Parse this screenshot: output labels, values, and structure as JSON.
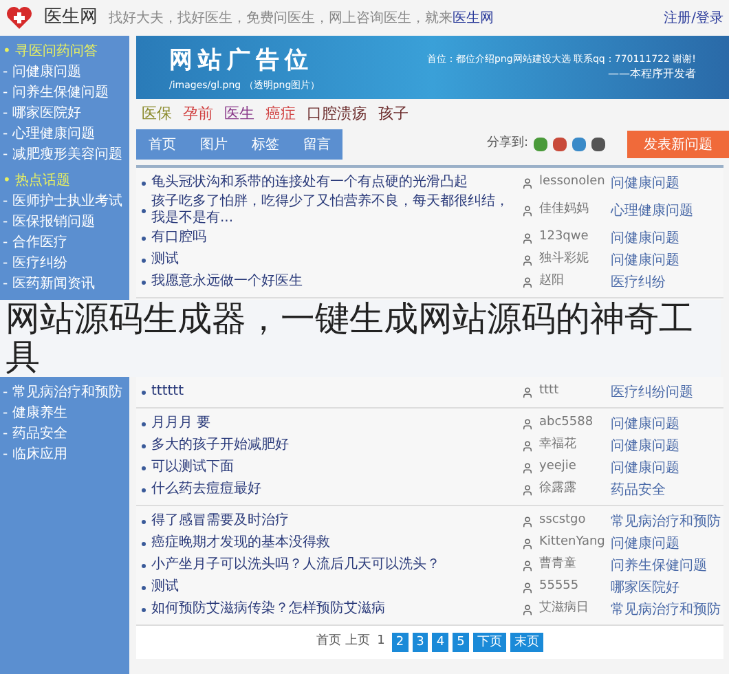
{
  "header": {
    "site_name": "医生网",
    "tagline": "找好大夫，找好医生，免费问医生，网上咨询医生，就来",
    "tagline_link": "医生网",
    "login": "注册/登录"
  },
  "sidebar": {
    "upper": [
      {
        "title": "• 寻医问药问答",
        "items": [
          "- 问健康问题",
          "- 问养生保健问题",
          "- 哪家医院好",
          "- 心理健康问题",
          "- 减肥瘦形美容问题"
        ]
      },
      {
        "title": "• 热点话题",
        "items": [
          "- 医师护士执业考试",
          "- 医保报销问题",
          "- 合作医疗",
          "- 医疗纠纷",
          "- 医药新闻资讯"
        ]
      }
    ],
    "lower": [
      {
        "items": [
          "- 常见病治疗和预防",
          "- 健康养生",
          "- 药品安全",
          "- 临床应用"
        ]
      }
    ]
  },
  "banner": {
    "title": "网站广告位",
    "path": "/images/gl.png （透明png图片）",
    "contact": "首位：都位介绍png网站建设大选  联系qq：770111722 谢谢!",
    "signature": "——本程序开发者"
  },
  "tags": [
    {
      "label": "医保",
      "color": "#8a8a2a"
    },
    {
      "label": "孕前",
      "color": "#d04040"
    },
    {
      "label": "医生",
      "color": "#8a3a8a"
    },
    {
      "label": "癌症",
      "color": "#d04040"
    },
    {
      "label": "口腔溃疡",
      "color": "#6a2a2a"
    },
    {
      "label": "孩子",
      "color": "#6a2a2a"
    }
  ],
  "nav": [
    "首页",
    "图片",
    "标签",
    "留言"
  ],
  "share": {
    "label": "分享到:"
  },
  "post_button": "发表新问题",
  "list": {
    "upper": [
      [
        {
          "title": "龟头冠状沟和系带的连接处有一个有点硬的光滑凸起",
          "user": "lessonolen",
          "category": "问健康问题"
        },
        {
          "title": "孩子吃多了怕胖，吃得少了又怕营养不良，每天都很纠结，我是不是有...",
          "user": "佳佳妈妈",
          "category": "心理健康问题"
        },
        {
          "title": "有口腔吗",
          "user": "123qwe",
          "category": "问健康问题"
        },
        {
          "title": "测试",
          "user": "独斗彩妮",
          "category": "问健康问题"
        },
        {
          "title": "我愿意永远做一个好医生",
          "user": "赵阳",
          "category": "医疗纠纷"
        }
      ]
    ],
    "lower": [
      [
        {
          "title": "tttttt",
          "user": "tttt",
          "category": "医疗纠纷问题"
        }
      ],
      [
        {
          "title": "月月月 要",
          "user": "abc5588",
          "category": "问健康问题"
        },
        {
          "title": "多大的孩子开始减肥好",
          "user": "幸福花",
          "category": "问健康问题"
        },
        {
          "title": "可以测试下面",
          "user": "yeejie",
          "category": "问健康问题"
        },
        {
          "title": "什么药去痘痘最好",
          "user": "徐露露",
          "category": "药品安全"
        }
      ],
      [
        {
          "title": "得了感冒需要及时治疗",
          "user": "sscstgo",
          "category": "常见病治疗和预防"
        },
        {
          "title": "癌症晚期才发现的基本没得救",
          "user": "KittenYang",
          "category": "问健康问题"
        },
        {
          "title": "小产坐月子可以洗头吗？人流后几天可以洗头？",
          "user": "曹青童",
          "category": "问养生保健问题"
        },
        {
          "title": "测试",
          "user": "55555",
          "category": "哪家医院好"
        },
        {
          "title": "如何预防艾滋病传染？怎样预防艾滋病",
          "user": "艾滋病日",
          "category": "常见病治疗和预防"
        }
      ]
    ]
  },
  "pagination": {
    "first": "首页",
    "prev": "上页",
    "pages": [
      {
        "label": "1",
        "selected": true
      },
      {
        "label": "2",
        "selected": false
      },
      {
        "label": "3",
        "selected": false
      },
      {
        "label": "4",
        "selected": false
      },
      {
        "label": "5",
        "selected": false
      }
    ],
    "next": "下页",
    "last": "末页"
  },
  "overlay_title": "网站源码生成器，一键生成网站源码的神奇工具"
}
